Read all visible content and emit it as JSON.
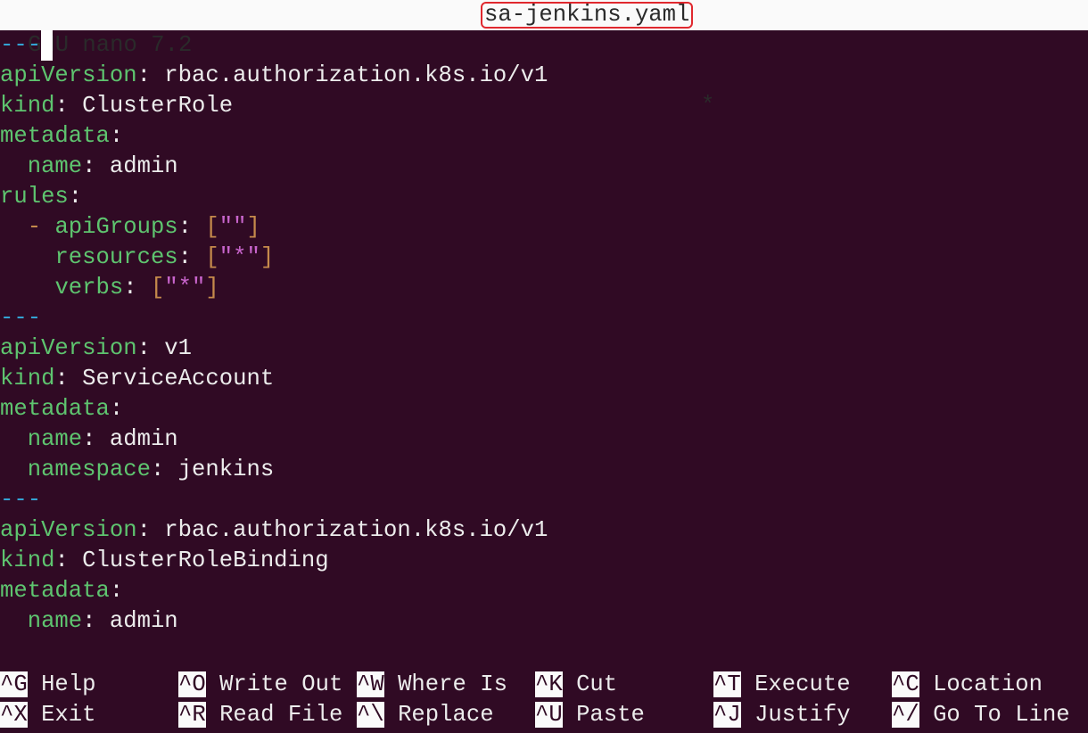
{
  "titlebar": {
    "app": "GNU nano 7.2",
    "filename": "sa-jenkins.yaml",
    "modified": "*"
  },
  "colors": {
    "background": "#300a24",
    "key": "#5ec46f",
    "separator": "#33a3d3",
    "punct": "#c58a4b",
    "string": "#c865cc"
  },
  "lines": [
    [
      [
        "---",
        "sep"
      ]
    ],
    [
      [
        "apiVersion",
        "k"
      ],
      [
        ": rbac.authorization.k8s.io/v1",
        ""
      ]
    ],
    [
      [
        "kind",
        "k"
      ],
      [
        ": ClusterRole",
        ""
      ]
    ],
    [
      [
        "metadata",
        "k"
      ],
      [
        ":",
        ""
      ]
    ],
    [
      [
        "  ",
        ""
      ],
      [
        "name",
        "k"
      ],
      [
        ": admin",
        ""
      ]
    ],
    [
      [
        "rules",
        "k"
      ],
      [
        ":",
        ""
      ]
    ],
    [
      [
        "  ",
        ""
      ],
      [
        "-",
        "p"
      ],
      [
        " ",
        ""
      ],
      [
        "apiGroups",
        "k"
      ],
      [
        ": ",
        ""
      ],
      [
        "[",
        "p"
      ],
      [
        "\"\"",
        "s"
      ],
      [
        "]",
        "p"
      ]
    ],
    [
      [
        "    ",
        ""
      ],
      [
        "resources",
        "k"
      ],
      [
        ": ",
        ""
      ],
      [
        "[",
        "p"
      ],
      [
        "\"*\"",
        "s"
      ],
      [
        "]",
        "p"
      ]
    ],
    [
      [
        "    ",
        ""
      ],
      [
        "verbs",
        "k"
      ],
      [
        ": ",
        ""
      ],
      [
        "[",
        "p"
      ],
      [
        "\"*\"",
        "s"
      ],
      [
        "]",
        "p"
      ]
    ],
    [
      [
        "---",
        "sep"
      ]
    ],
    [
      [
        "apiVersion",
        "k"
      ],
      [
        ": v1",
        ""
      ]
    ],
    [
      [
        "kind",
        "k"
      ],
      [
        ": ServiceAccount",
        ""
      ]
    ],
    [
      [
        "metadata",
        "k"
      ],
      [
        ":",
        ""
      ]
    ],
    [
      [
        "  ",
        ""
      ],
      [
        "name",
        "k"
      ],
      [
        ": admin",
        ""
      ]
    ],
    [
      [
        "  ",
        ""
      ],
      [
        "namespace",
        "k"
      ],
      [
        ": jenkins",
        ""
      ]
    ],
    [
      [
        "---",
        "sep"
      ]
    ],
    [
      [
        "apiVersion",
        "k"
      ],
      [
        ": rbac.authorization.k8s.io/v1",
        ""
      ]
    ],
    [
      [
        "kind",
        "k"
      ],
      [
        ": ClusterRoleBinding",
        ""
      ]
    ],
    [
      [
        "metadata",
        "k"
      ],
      [
        ":",
        ""
      ]
    ],
    [
      [
        "  ",
        ""
      ],
      [
        "name",
        "k"
      ],
      [
        ": admin",
        ""
      ]
    ]
  ],
  "shortcuts": [
    [
      {
        "key": "^G",
        "label": "Help"
      },
      {
        "key": "^O",
        "label": "Write Out"
      },
      {
        "key": "^W",
        "label": "Where Is"
      },
      {
        "key": "^K",
        "label": "Cut"
      },
      {
        "key": "^T",
        "label": "Execute"
      },
      {
        "key": "^C",
        "label": "Location"
      }
    ],
    [
      {
        "key": "^X",
        "label": "Exit"
      },
      {
        "key": "^R",
        "label": "Read File"
      },
      {
        "key": "^\\",
        "label": "Replace"
      },
      {
        "key": "^U",
        "label": "Paste"
      },
      {
        "key": "^J",
        "label": "Justify"
      },
      {
        "key": "^/",
        "label": "Go To Line"
      }
    ]
  ]
}
